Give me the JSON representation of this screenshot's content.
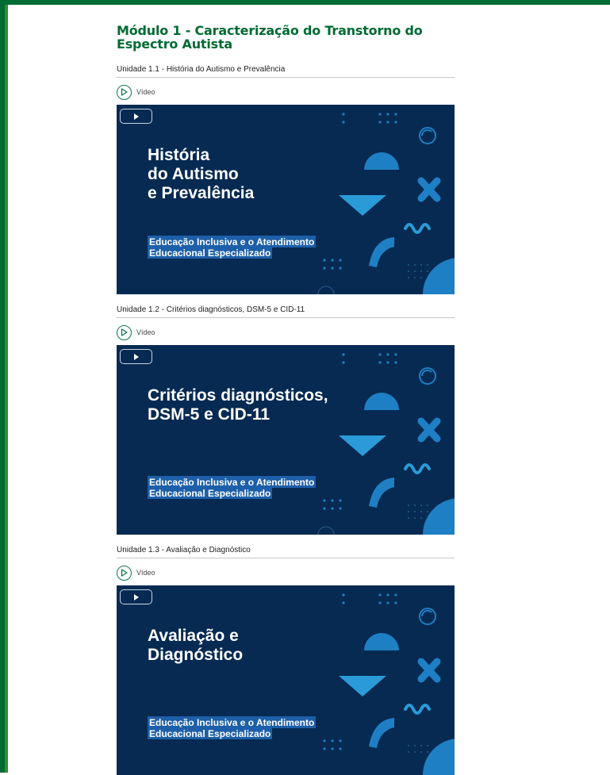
{
  "module": {
    "title": "Módulo 1 - Caracterização do Transtorno do Espectro Autista"
  },
  "units": [
    {
      "title": "Unidade 1.1 - História do Autismo e Prevalência",
      "media_label": "Vídeo",
      "thumbnail": {
        "title": "História\ndo Autismo\ne Prevalência",
        "subtitle_line1": "Educação Inclusiva e o Atendimento",
        "subtitle_line2": "Educacional Especializado"
      }
    },
    {
      "title": "Unidade 1.2 - Critérios diagnósticos, DSM-5 e CID-11",
      "media_label": "Vídeo",
      "thumbnail": {
        "title": "Critérios diagnósticos,\nDSM-5 e CID-11",
        "subtitle_line1": "Educação Inclusiva e o Atendimento",
        "subtitle_line2": "Educacional Especializado"
      }
    },
    {
      "title": "Unidade 1.3 - Avaliação e Diagnóstico",
      "media_label": "Vídeo",
      "thumbnail": {
        "title": "Avaliação e\nDiagnóstico",
        "subtitle_line1": "Educação Inclusiva e o Atendimento",
        "subtitle_line2": "Educacional Especializado"
      }
    }
  ],
  "colors": {
    "brand_green": "#006b33",
    "thumb_bg": "#062a52",
    "accent_blue": "#1f7fc4",
    "highlight_blue": "#1d5fa8"
  },
  "icons": {
    "media": "play-circle-icon",
    "thumb_play": "play-button-icon"
  }
}
